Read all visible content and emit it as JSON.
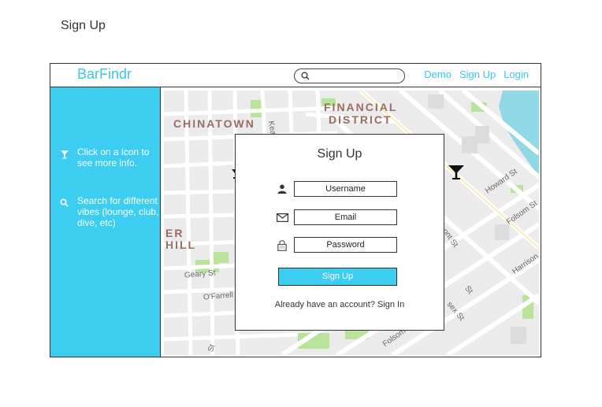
{
  "page": {
    "heading": "Sign Up"
  },
  "navbar": {
    "brand": "BarFindr",
    "search": {
      "placeholder": "",
      "value": ""
    },
    "links": {
      "demo": "Demo",
      "signup": "Sign Up",
      "login": "Login"
    }
  },
  "sidebar": {
    "tips": [
      {
        "icon": "cocktail-icon",
        "text": "Click on a icon to see more info."
      },
      {
        "icon": "search-icon",
        "text": "Search for different vibes (lounge, club, dive, etc)"
      }
    ]
  },
  "map": {
    "districts": {
      "chinatown": "CHINATOWN",
      "financial": "FINANCIAL",
      "district": "DISTRICT",
      "nob": "ER",
      "hill": "HILL"
    },
    "streets": {
      "kearny": "Kea",
      "howard": "Howard St",
      "folsom": "Folsom St",
      "folsom2": "Folsom St",
      "geary": "Geary St",
      "ofarrell": "O'Farrell",
      "mont": "ont St",
      "harrison": "Harrison",
      "sex": "sex St",
      "st1": "St",
      "st2": "St"
    },
    "marker_icon": "martini-glass-icon"
  },
  "modal": {
    "title": "Sign Up",
    "username_placeholder": "Username",
    "email_placeholder": "Email",
    "password_placeholder": "Password",
    "submit_label": "Sign Up",
    "signin_note": "Already have an account? Sign In"
  },
  "colors": {
    "accent": "#3dcdf0",
    "brand": "#3cc8e8",
    "water": "#8fd8e6",
    "park": "#b9e39a"
  }
}
